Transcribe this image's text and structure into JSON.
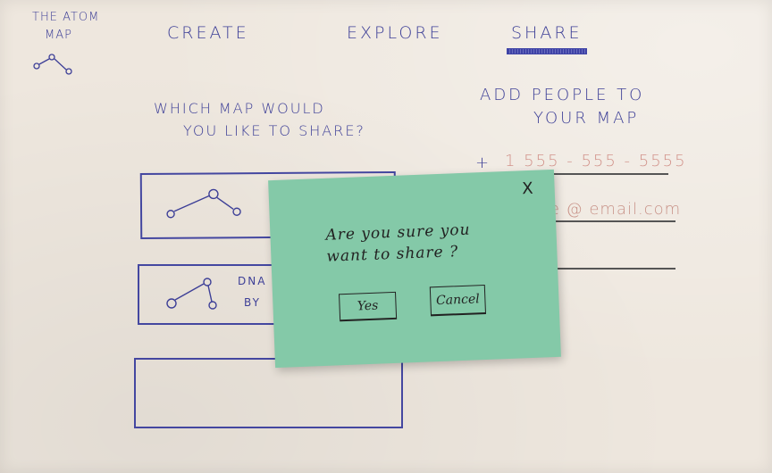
{
  "logo": {
    "line1": "THE ATOM",
    "line2": "MAP"
  },
  "nav": {
    "create": "CREATE",
    "explore": "EXPLORE",
    "share": "SHARE"
  },
  "left_panel": {
    "question_line1": "WHICH  MAP  WOULD",
    "question_line2": "YOU  LIKE  TO  SHARE?",
    "cards": [
      {
        "label_line1": "",
        "label_line2": ""
      },
      {
        "label_line1": "DNA",
        "label_line2": "BY"
      },
      {
        "label_line1": "",
        "label_line2": ""
      }
    ]
  },
  "right_panel": {
    "title_line1": "ADD  PEOPLE  TO",
    "title_line2": "YOUR  MAP",
    "add_symbol": "+",
    "phone_placeholder": "1  555 - 555 - 5555",
    "email_placeholder": "nple @ email.com"
  },
  "dialog": {
    "message_line1": "Are you sure you",
    "message_line2": "want to share ?",
    "yes_label": "Yes",
    "cancel_label": "Cancel",
    "close_label": "X"
  }
}
